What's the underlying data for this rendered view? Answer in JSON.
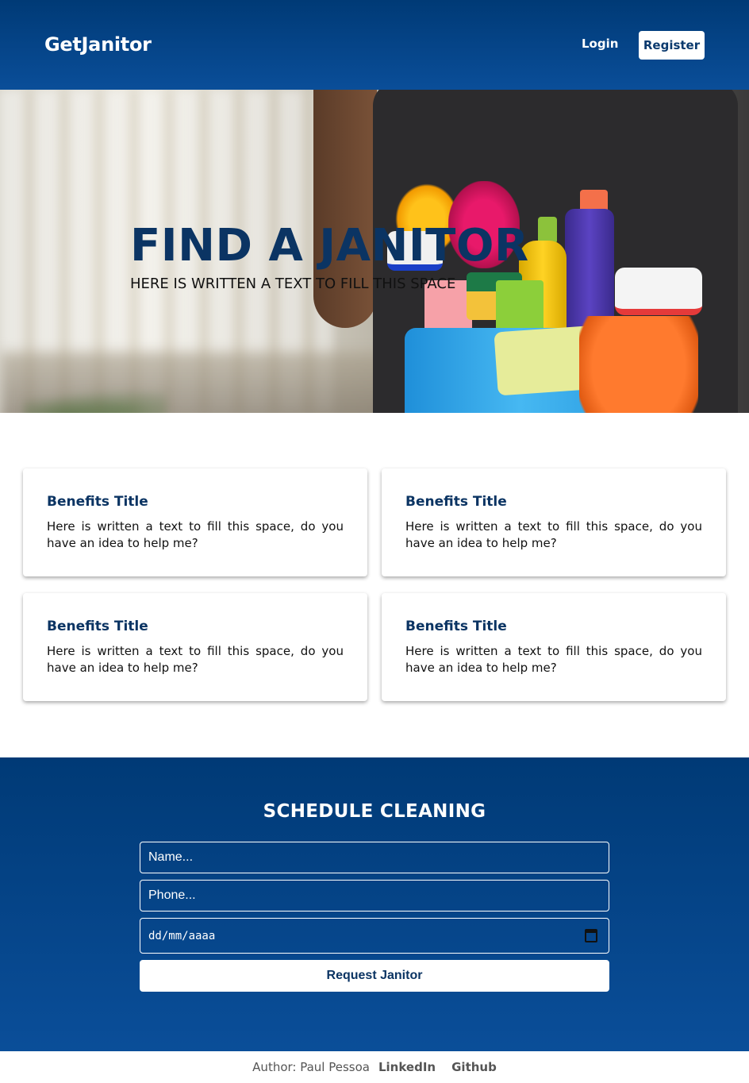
{
  "header": {
    "logo": "GetJanitor",
    "login_label": "Login",
    "register_label": "Register"
  },
  "hero": {
    "title": "FIND A JANITOR",
    "subtitle": "HERE IS WRITTEN A TEXT TO FILL THIS SPACE"
  },
  "benefits": [
    {
      "title": "Benefits Title",
      "text": "Here is written a text to fill this space, do you have an idea to help me?"
    },
    {
      "title": "Benefits Title",
      "text": "Here is written a text to fill this space, do you have an idea to help me?"
    },
    {
      "title": "Benefits Title",
      "text": "Here is written a text to fill this space, do you have an idea to help me?"
    },
    {
      "title": "Benefits Title",
      "text": "Here is written a text to fill this space, do you have an idea to help me?"
    }
  ],
  "schedule": {
    "title": "SCHEDULE CLEANING",
    "name_placeholder": "Name...",
    "phone_placeholder": "Phone...",
    "date_placeholder": "dd/mm/aaaa",
    "submit_label": "Request Janitor"
  },
  "footer": {
    "author": "Author: Paul Pessoa",
    "linkedin": "LinkedIn",
    "github": "Github"
  },
  "colors": {
    "brand_dark": "#003a76",
    "brand": "#0a4e99",
    "title_navy": "#0b3463"
  }
}
